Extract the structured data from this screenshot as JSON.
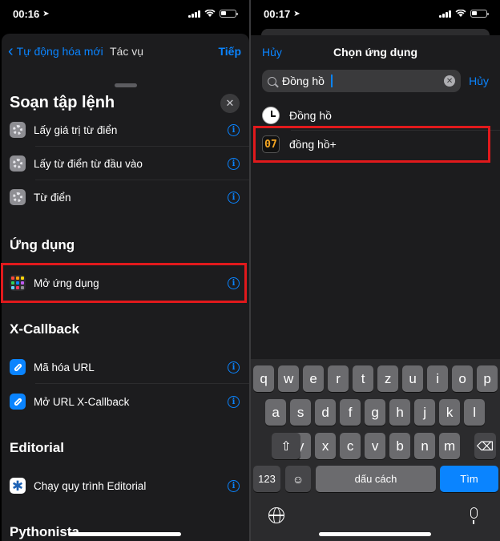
{
  "left": {
    "status": {
      "time": "00:16"
    },
    "background_nav": {
      "back_label": "Tự động hóa mới",
      "title": "Tác vụ",
      "next_label": "Tiếp"
    },
    "sheet": {
      "title": "Soạn tập lệnh",
      "rows_top": [
        {
          "label": "Lấy giá trị từ điển",
          "icon": "gear-icon"
        },
        {
          "label": "Lấy từ điển từ đầu vào",
          "icon": "gear-icon"
        },
        {
          "label": "Từ điển",
          "icon": "gear-icon"
        }
      ],
      "section_apps": "Ứng dụng",
      "open_app_row": {
        "label": "Mở ứng dụng",
        "icon": "app-grid-icon"
      },
      "section_xcallback": "X-Callback",
      "xcallback_rows": [
        {
          "label": "Mã hóa URL",
          "icon": "link-icon"
        },
        {
          "label": "Mở URL X-Callback",
          "icon": "link-icon"
        }
      ],
      "section_editorial": "Editorial",
      "editorial_row": {
        "label": "Chạy quy trình Editorial",
        "icon": "editorial-icon"
      },
      "section_pythonista": "Pythonista"
    }
  },
  "right": {
    "status": {
      "time": "00:17"
    },
    "nav": {
      "cancel_label": "Hủy",
      "title": "Chọn ứng dụng"
    },
    "search": {
      "value": "Đồng hồ",
      "cancel_label": "Hủy"
    },
    "results": [
      {
        "label": "Đồng hồ",
        "icon": "clock-icon"
      },
      {
        "label": "đồng hồ+",
        "icon": "clock-07-icon",
        "badge": "07"
      }
    ],
    "keyboard": {
      "row1": [
        "q",
        "w",
        "e",
        "r",
        "t",
        "z",
        "u",
        "i",
        "o",
        "p"
      ],
      "row2": [
        "a",
        "s",
        "d",
        "f",
        "g",
        "h",
        "j",
        "k",
        "l"
      ],
      "row3": [
        "y",
        "x",
        "c",
        "v",
        "b",
        "n",
        "m"
      ],
      "numbers_label": "123",
      "space_label": "dấu cách",
      "go_label": "Tìm"
    }
  },
  "colors": {
    "accent": "#0a84ff",
    "highlight": "#e1191c",
    "sheet_bg": "#1c1c1e"
  }
}
